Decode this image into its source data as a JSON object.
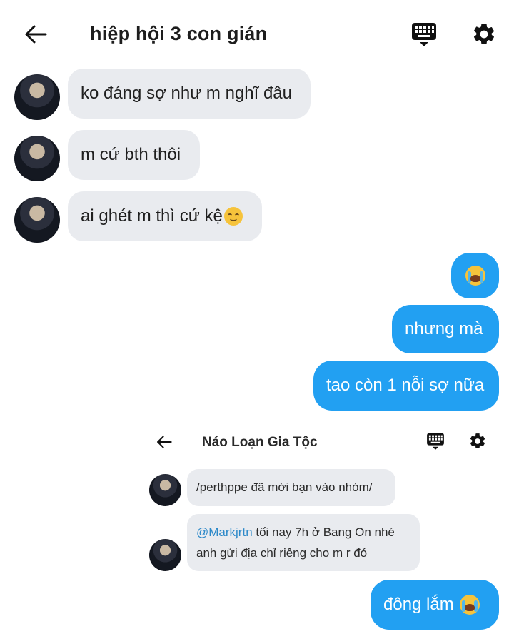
{
  "header": {
    "title": "hiệp hội 3 con gián"
  },
  "incoming": [
    {
      "text": "ko đáng sợ như m nghĩ đâu"
    },
    {
      "text": "m cứ bth thôi"
    },
    {
      "text": "ai ghét m thì cứ kệ"
    }
  ],
  "outgoing": [
    {
      "text": ""
    },
    {
      "text": "nhưng mà"
    },
    {
      "text": "tao còn 1 nỗi sợ nữa"
    }
  ],
  "embedded": {
    "title": "Náo Loạn Gia Tộc",
    "system_message": "/perthppe đã mời bạn vào nhóm/",
    "mention": "@Markjrtn",
    "message_rest_line1": " tối nay 7h ở Bang On nhé",
    "message_line2": "anh gửi địa chỉ riêng cho m r đó",
    "reply": "đông lắm"
  },
  "colors": {
    "outgoing_bubble": "#22a0f2",
    "incoming_bubble": "#e9ebef",
    "mention": "#2d89c9"
  },
  "icons": [
    "back-arrow-icon",
    "keyboard-icon",
    "gear-icon",
    "relieved-face-emoji",
    "crying-face-emoji"
  ]
}
